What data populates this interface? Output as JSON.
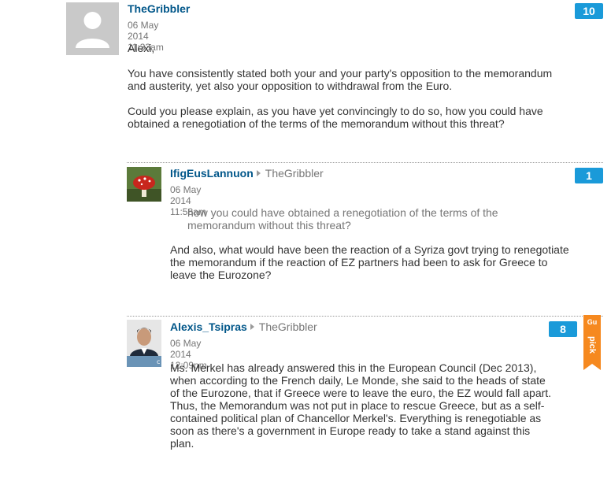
{
  "comments": [
    {
      "author": "TheGribbler",
      "timestamp": "06 May 2014 11:33am",
      "recommends": "10",
      "paragraphs": [
        "Alexi,",
        "You have consistently stated both your and your party's opposition to the memorandum and austerity, yet also your opposition to withdrawal from the Euro.",
        "Could you please explain, as you have yet convincingly to do so, how you could have obtained a renegotiation of the terms of the memorandum without this threat?"
      ]
    },
    {
      "author": "IfigEusLannuon",
      "reply_to": "TheGribbler",
      "timestamp": "06 May 2014 11:58am",
      "recommends": "1",
      "quote": "how you could have obtained a renegotiation of the terms of the memorandum without this threat?",
      "paragraphs": [
        "And also, what would have been the reaction of a Syriza govt trying to renegotiate the memorandum if the reaction of EZ partners had been to ask for Greece to leave the Eurozone?"
      ]
    },
    {
      "author": "Alexis_Tsipras",
      "reply_to": "TheGribbler",
      "timestamp": "06 May 2014 12:09pm",
      "recommends": "8",
      "pick_label": "pick",
      "paragraphs": [
        "Ms. Merkel has already answered this in the European Council (Dec 2013), when according to the French daily, Le Monde, she said to the heads of state of the Eurozone, that if Greece were to leave the euro, the EZ would fall apart.",
        "Thus, the Memorandum was not put in place to rescue Greece, but as a self-contained political plan of Chancellor Merkel's. Everything is renegotiable as soon as there's a government in Europe ready to take a stand against this plan."
      ]
    }
  ],
  "colors": {
    "author": "#005689",
    "badge": "#1a9ad9",
    "pick": "#f6891f",
    "meta": "#767676"
  },
  "icons": {
    "default_avatar": "default-avatar-icon",
    "reply_arrow": "reply-arrow-icon",
    "pick_flag": "guardian-pick-icon"
  }
}
